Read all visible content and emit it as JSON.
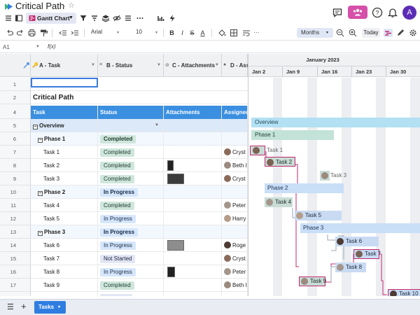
{
  "app": {
    "title": "Critical Path",
    "title_chevron": "⌄",
    "star": "☆",
    "view_name": "Gantt Chart",
    "avatar_initial": "A",
    "brand_color": "#d64fa8",
    "accent_color": "#2f7de1"
  },
  "toolbar": {
    "font_name": "Arial",
    "font_size": "10",
    "zoom": "Months",
    "today_label": "Today",
    "bold": "B",
    "italic": "I",
    "strike": "S",
    "underline_a": "A"
  },
  "formula": {
    "cell_ref": "A1",
    "fx": "f(x)"
  },
  "columns": {
    "a": "A - Task",
    "b": "B - Status",
    "c": "C - Attachments",
    "d": "D - Ass"
  },
  "sheet": {
    "title": "Critical Path",
    "header": {
      "task": "Task",
      "status": "Status",
      "attachments": "Attachments",
      "assigned": "Assigned"
    },
    "rows": [
      {
        "num": "1"
      },
      {
        "num": "2"
      },
      {
        "num": "3"
      },
      {
        "num": "4"
      },
      {
        "num": "5",
        "task": "Overview"
      },
      {
        "num": "6",
        "task": "Phase 1",
        "status": "Completed"
      },
      {
        "num": "7",
        "task": "Task 1",
        "status": "Completed",
        "assigned": "Cryst"
      },
      {
        "num": "8",
        "task": "Task 2",
        "status": "Completed",
        "assigned": "Beth I"
      },
      {
        "num": "9",
        "task": "Task 3",
        "status": "Completed",
        "assigned": "Cryst"
      },
      {
        "num": "10",
        "task": "Phase 2",
        "status": "In Progress"
      },
      {
        "num": "11",
        "task": "Task 4",
        "status": "Completed",
        "assigned": "Peter"
      },
      {
        "num": "12",
        "task": "Task 5",
        "status": "In Progress",
        "assigned": "Harry"
      },
      {
        "num": "13",
        "task": "Phase 3",
        "status": "In Progress"
      },
      {
        "num": "14",
        "task": "Task 6",
        "status": "In Progress",
        "assigned": "Roge"
      },
      {
        "num": "15",
        "task": "Task 7",
        "status": "Not Started",
        "assigned": "Cryst"
      },
      {
        "num": "16",
        "task": "Task 8",
        "status": "In Progress",
        "assigned": "Peter"
      },
      {
        "num": "17",
        "task": "Task 9",
        "status": "Completed",
        "assigned": "Beth I"
      },
      {
        "num": "18",
        "task": "",
        "status": ""
      }
    ]
  },
  "gantt": {
    "month": "January 2023",
    "weeks": [
      "Jan 2",
      "Jan 9",
      "Jan 16",
      "Jan 23",
      "Jan 30"
    ],
    "bars": {
      "overview": "Overview",
      "phase1": "Phase 1",
      "task1": "Task 1",
      "task2": "Task 2",
      "task3": "Task 3",
      "phase2": "Phase 2",
      "task4": "Task 4",
      "task5": "Task 5",
      "phase3": "Phase 3",
      "task6": "Task 6",
      "task7": "Task 7",
      "task8": "Task 8",
      "task9": "Task 9",
      "task_last": "Task 10"
    },
    "critical_color": "#c2286f"
  },
  "bottom": {
    "tab": "Tasks",
    "tab_chevron": "▾",
    "menu": "☰",
    "add": "+"
  }
}
